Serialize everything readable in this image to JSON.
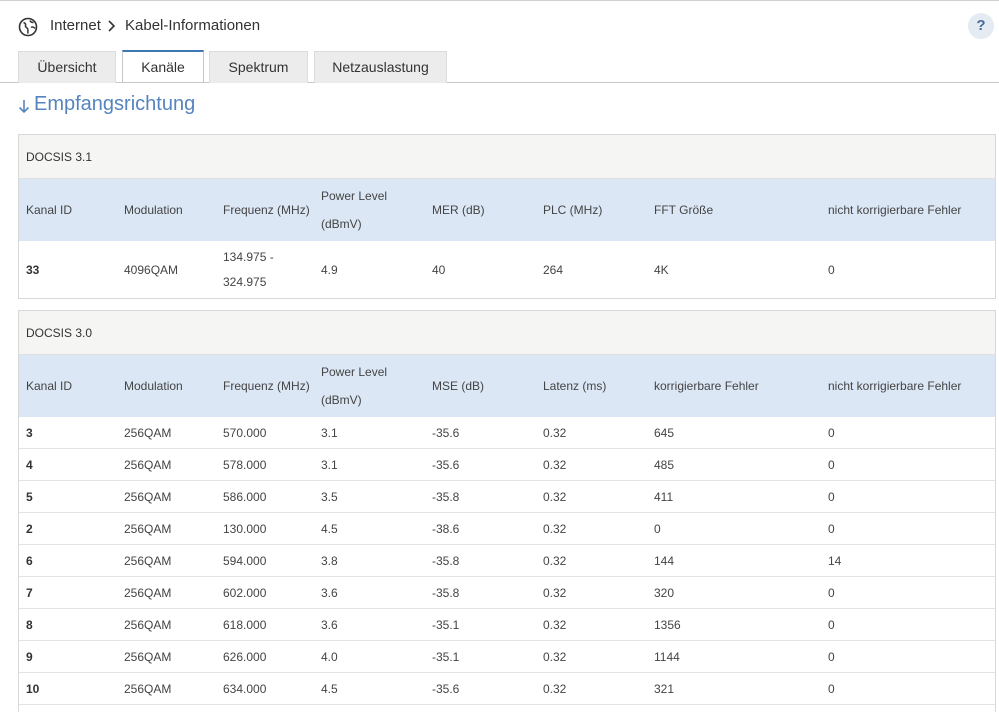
{
  "breadcrumb": {
    "root": "Internet",
    "current": "Kabel-Informationen"
  },
  "help_label": "?",
  "tabs": [
    {
      "label": "Übersicht"
    },
    {
      "label": "Kanäle"
    },
    {
      "label": "Spektrum"
    },
    {
      "label": "Netzauslastung"
    }
  ],
  "section_title": "Empfangsrichtung",
  "docsis31": {
    "title": "DOCSIS 3.1",
    "columns": [
      "Kanal ID",
      "Modulation",
      "Frequenz (MHz)",
      "Power Level",
      "(dBmV)",
      "MER (dB)",
      "PLC (MHz)",
      "FFT Größe",
      "nicht korrigierbare Fehler"
    ],
    "row": {
      "kanal": "33",
      "modulation": "4096QAM",
      "freq_1": "134.975 -",
      "freq_2": "324.975",
      "power": "4.9",
      "mer": "40",
      "plc": "264",
      "fft": "4K",
      "nkf": "0"
    }
  },
  "docsis30": {
    "title": "DOCSIS 3.0",
    "columns": [
      "Kanal ID",
      "Modulation",
      "Frequenz (MHz)",
      "Power Level",
      "(dBmV)",
      "MSE (dB)",
      "Latenz (ms)",
      "korrigierbare Fehler",
      "nicht korrigierbare Fehler"
    ],
    "rows": [
      [
        "3",
        "256QAM",
        "570.000",
        "3.1",
        "-35.6",
        "0.32",
        "645",
        "0"
      ],
      [
        "4",
        "256QAM",
        "578.000",
        "3.1",
        "-35.6",
        "0.32",
        "485",
        "0"
      ],
      [
        "5",
        "256QAM",
        "586.000",
        "3.5",
        "-35.8",
        "0.32",
        "411",
        "0"
      ],
      [
        "2",
        "256QAM",
        "130.000",
        "4.5",
        "-38.6",
        "0.32",
        "0",
        "0"
      ],
      [
        "6",
        "256QAM",
        "594.000",
        "3.8",
        "-35.8",
        "0.32",
        "144",
        "14"
      ],
      [
        "7",
        "256QAM",
        "602.000",
        "3.6",
        "-35.8",
        "0.32",
        "320",
        "0"
      ],
      [
        "8",
        "256QAM",
        "618.000",
        "3.6",
        "-35.1",
        "0.32",
        "1356",
        "0"
      ],
      [
        "9",
        "256QAM",
        "626.000",
        "4.0",
        "-35.1",
        "0.32",
        "1144",
        "0"
      ],
      [
        "10",
        "256QAM",
        "634.000",
        "4.5",
        "-35.6",
        "0.32",
        "321",
        "0"
      ]
    ]
  }
}
